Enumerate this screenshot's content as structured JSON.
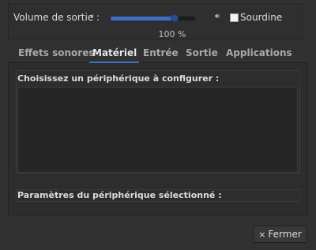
{
  "volume": {
    "label": "Volume de sortie :",
    "level_percent": 76,
    "percent_label": "100 %",
    "mute_label": "Sourdine",
    "mute_checked": false,
    "icon_low": "speaker-low-icon",
    "icon_high": "speaker-high-icon",
    "accent": "#3b70c4"
  },
  "tabs": [
    {
      "label": "Effets sonores",
      "active": false
    },
    {
      "label": "Matériel",
      "active": true
    },
    {
      "label": "Entrée",
      "active": false
    },
    {
      "label": "Sortie",
      "active": false
    },
    {
      "label": "Applications",
      "active": false
    }
  ],
  "hardware": {
    "devices_title": "Choisissez un périphérique à configurer :",
    "settings_title": "Paramètres du périphérique sélectionné :"
  },
  "footer": {
    "close_icon": "×",
    "close_label": "Fermer"
  }
}
